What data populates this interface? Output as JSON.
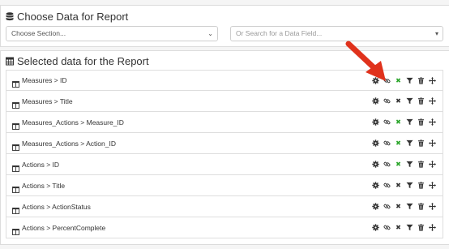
{
  "choose": {
    "title": "Choose Data for Report",
    "section_placeholder": "Choose Section...",
    "search_placeholder": "Or Search for a Data Field..."
  },
  "selected": {
    "title": "Selected data for the Report",
    "rows": [
      {
        "label": "Measures > ID",
        "remove_color": "green"
      },
      {
        "label": "Measures > Title",
        "remove_color": "dark"
      },
      {
        "label": "Measures_Actions > Measure_ID",
        "remove_color": "green"
      },
      {
        "label": "Measures_Actions > Action_ID",
        "remove_color": "green"
      },
      {
        "label": "Actions > ID",
        "remove_color": "green"
      },
      {
        "label": "Actions > Title",
        "remove_color": "dark"
      },
      {
        "label": "Actions > ActionStatus",
        "remove_color": "dark"
      },
      {
        "label": "Actions > PercentComplete",
        "remove_color": "dark"
      }
    ]
  },
  "icons": {
    "title_choose": "database-icon",
    "title_selected": "table-icon",
    "row": "columns-icon",
    "actions": [
      "gear-icon",
      "link-icon",
      "remove-icon",
      "filter-icon",
      "trash-icon",
      "move-icon"
    ]
  },
  "colors": {
    "remove_green": "#2aa52a",
    "annotation_arrow": "#e0321c"
  }
}
